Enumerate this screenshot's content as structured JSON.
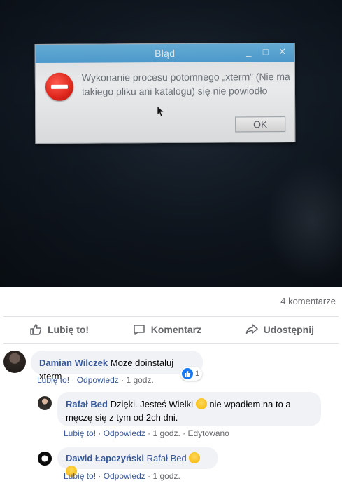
{
  "dialog": {
    "title": "Błąd",
    "controls": [
      "_",
      "□",
      "✕"
    ],
    "message": "Wykonanie procesu potomnego „xterm” (Nie ma takiego pliku ani katalogu) się nie powiodło",
    "ok_label": "OK",
    "icon": "error-icon"
  },
  "post": {
    "comment_count": "4 komentarze",
    "actions": {
      "like": "Lubię to!",
      "comment": "Komentarz",
      "share": "Udostępnij"
    }
  },
  "comments": [
    {
      "author": "Damian Wilczek",
      "text": "Moze doinstaluj xterm",
      "like": "Lubię to!",
      "reply": "Odpowiedz",
      "time": "1 godz.",
      "reaction_count": "1"
    },
    {
      "author": "Rafał Bed",
      "text_before": "Dzięki. Jesteś Wielki",
      "text_after": "nie wpadłem na to a męczę się z tym od 2ch dni.",
      "like": "Lubię to!",
      "reply": "Odpowiedz",
      "time": "1 godz.",
      "edited": "Edytowano"
    },
    {
      "author": "Dawid Łapczyński",
      "text": "Rafał Bed",
      "like": "Lubię to!",
      "reply": "Odpowiedz",
      "time": "1 godz."
    }
  ],
  "colors": {
    "link": "#385898",
    "titlebar": "#4f9fd3",
    "error": "#e0261c",
    "like_blue": "#1877f2"
  }
}
